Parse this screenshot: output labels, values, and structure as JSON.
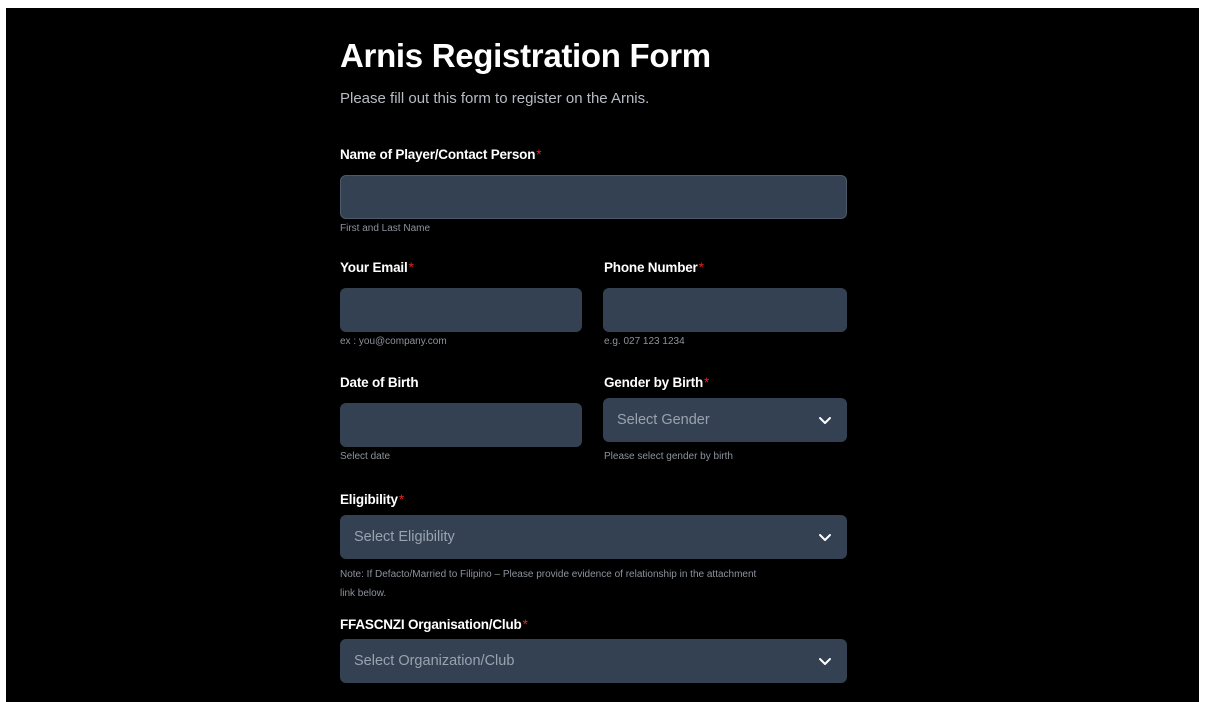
{
  "form": {
    "title": "Arnis Registration Form",
    "subtitle": "Please fill out this form to register on the Arnis.",
    "required_marker": "*",
    "accent_required_color": "#e02424",
    "field_background": "#334152",
    "name": {
      "label": "Name of Player/Contact Person",
      "value": "",
      "hint": "First and Last Name"
    },
    "email": {
      "label": "Your Email",
      "value": "",
      "hint": "ex : you@company.com"
    },
    "phone": {
      "label": "Phone Number",
      "value": "",
      "hint": "e.g. 027 123 1234"
    },
    "dob": {
      "label": "Date of Birth",
      "value": "",
      "hint": "Select date"
    },
    "gender": {
      "label": "Gender by Birth",
      "selected": "Select Gender",
      "hint": "Please select gender by birth",
      "icon": "chevron-down-icon"
    },
    "eligibility": {
      "label": "Eligibility",
      "selected": "Select Eligibility",
      "note_line1": "Note: If Defacto/Married to Filipino – Please provide evidence of relationship in the attachment",
      "note_line2": "link below.",
      "icon": "chevron-down-icon"
    },
    "organisation": {
      "label": "FFASCNZI Organisation/Club",
      "selected": "Select Organization/Club",
      "icon": "chevron-down-icon"
    }
  }
}
